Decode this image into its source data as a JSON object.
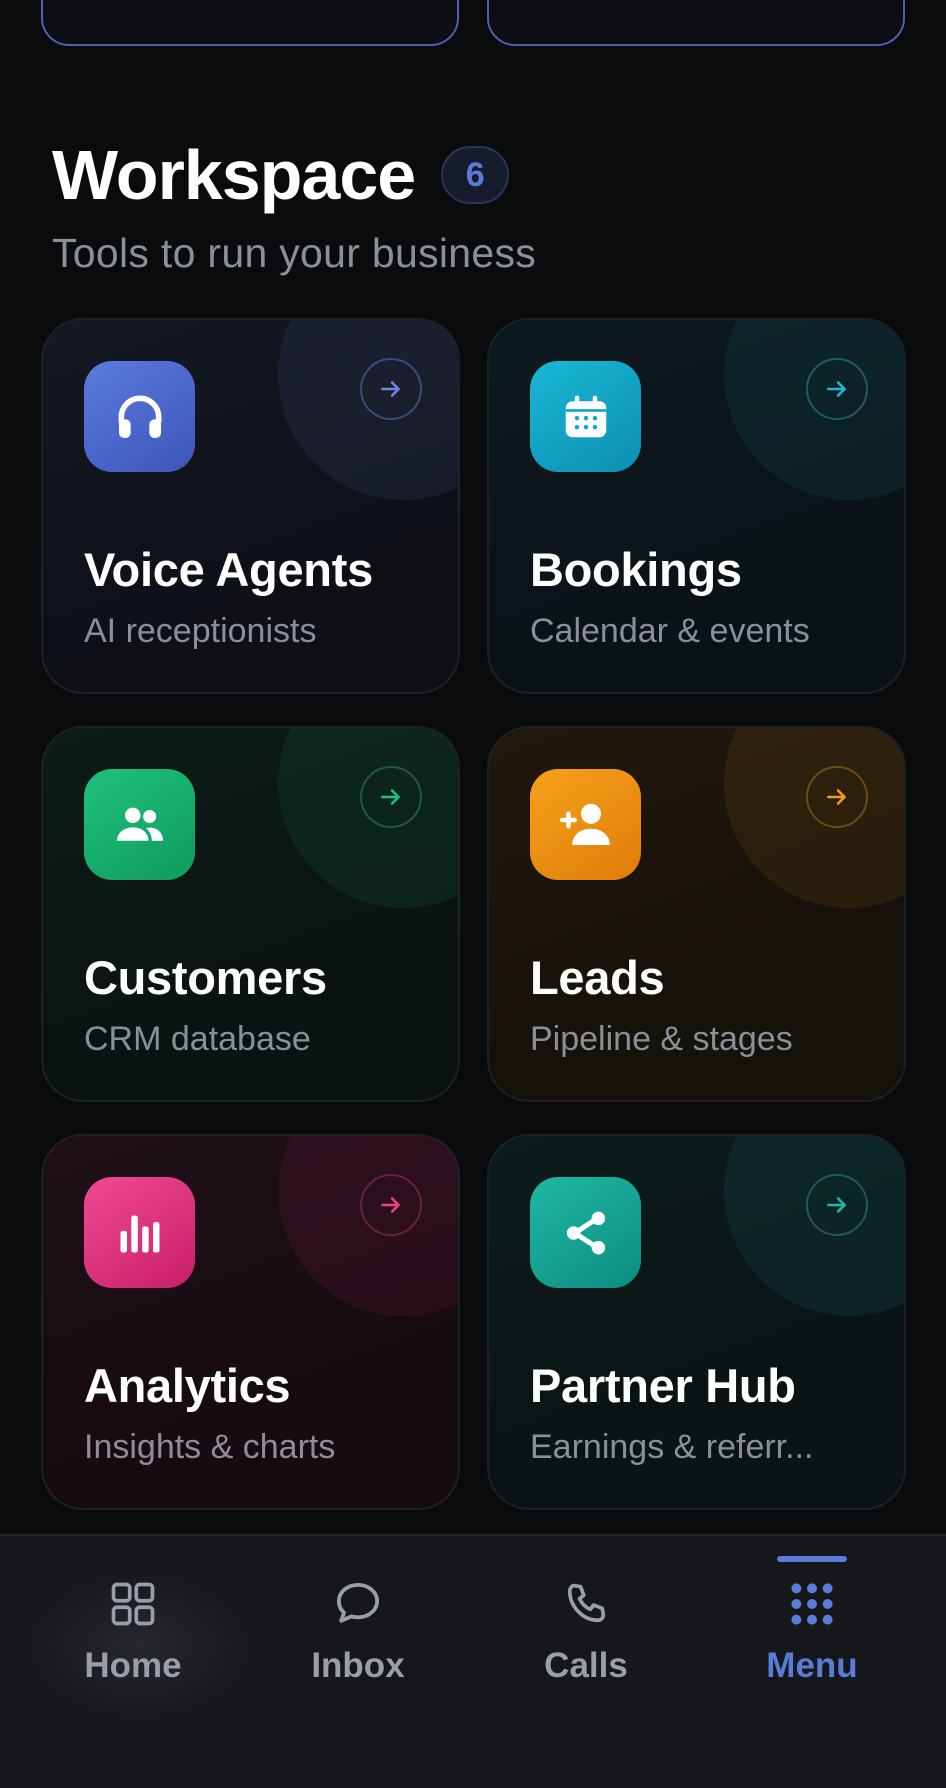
{
  "workspace": {
    "title": "Workspace",
    "count": "6",
    "subtitle": "Tools to run your business"
  },
  "tiles": [
    {
      "title": "Voice Agents",
      "subtitle": "AI receptionists",
      "icon": "headphones-icon",
      "accent": "#4f6ad0"
    },
    {
      "title": "Bookings",
      "subtitle": "Calendar & events",
      "icon": "calendar-icon",
      "accent": "#14a8c8"
    },
    {
      "title": "Customers",
      "subtitle": "CRM database",
      "icon": "users-icon",
      "accent": "#18b06e"
    },
    {
      "title": "Leads",
      "subtitle": "Pipeline & stages",
      "icon": "add-user-icon",
      "accent": "#f08f12"
    },
    {
      "title": "Analytics",
      "subtitle": "Insights & charts",
      "icon": "bar-chart-icon",
      "accent": "#e0337f"
    },
    {
      "title": "Partner Hub",
      "subtitle": "Earnings & referr...",
      "icon": "share-icon",
      "accent": "#16a394"
    }
  ],
  "tabbar": {
    "items": [
      {
        "label": "Home",
        "icon": "grid-icon",
        "active": false
      },
      {
        "label": "Inbox",
        "icon": "chat-icon",
        "active": false
      },
      {
        "label": "Calls",
        "icon": "phone-icon",
        "active": false
      },
      {
        "label": "Menu",
        "icon": "dots-grid-icon",
        "active": true
      }
    ],
    "active_color": "#5a7bd8"
  }
}
